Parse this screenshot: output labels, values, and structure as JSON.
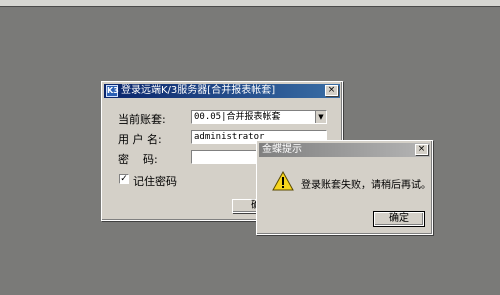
{
  "login_dialog": {
    "title": "登录远端K/3服务器[合并报表帐套]",
    "account_label": "当前账套:",
    "account_value": "00.05|合并报表帐套",
    "user_label": "用 户 名:",
    "user_value": "administrator",
    "password_label": "密    码:",
    "password_value": "",
    "remember_label": "记住密码",
    "remember_checked": true,
    "ok_label": "确定",
    "close_glyph": "×",
    "icon_glyph": "K3"
  },
  "alert_dialog": {
    "title": "金蝶提示",
    "message": "登录账套失败，请稍后再试。",
    "ok_label": "确定",
    "close_glyph": "×"
  }
}
